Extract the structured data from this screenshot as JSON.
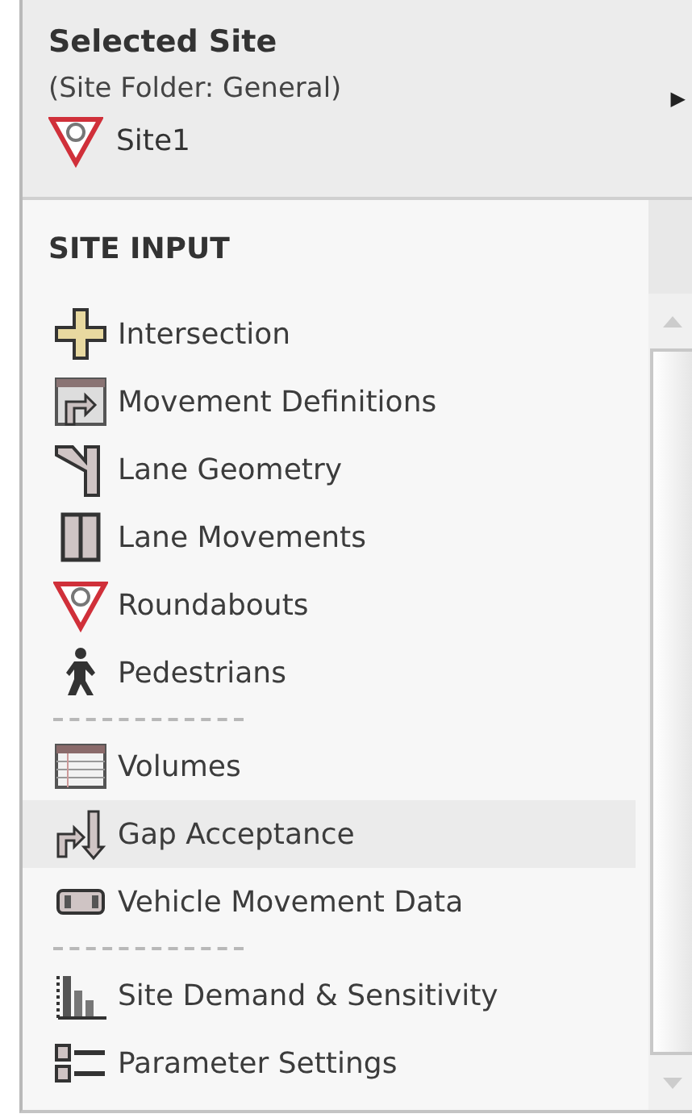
{
  "selected_site": {
    "title": "Selected Site",
    "folder": "(Site Folder: General)",
    "site": "Site1",
    "expand_arrow": "▶"
  },
  "section_title": "SITE INPUT",
  "entries": [
    {
      "kind": "item",
      "label": "Intersection",
      "selected": false
    },
    {
      "kind": "item",
      "label": "Movement Definitions",
      "selected": false
    },
    {
      "kind": "item",
      "label": "Lane Geometry",
      "selected": false
    },
    {
      "kind": "item",
      "label": "Lane Movements",
      "selected": false
    },
    {
      "kind": "item",
      "label": "Roundabouts",
      "selected": false
    },
    {
      "kind": "item",
      "label": "Pedestrians",
      "selected": false
    },
    {
      "kind": "separator"
    },
    {
      "kind": "item",
      "label": "Volumes",
      "selected": false
    },
    {
      "kind": "item",
      "label": "Gap Acceptance",
      "selected": true
    },
    {
      "kind": "item",
      "label": "Vehicle Movement Data",
      "selected": false
    },
    {
      "kind": "separator"
    },
    {
      "kind": "item",
      "label": "Site Demand & Sensitivity",
      "selected": false
    },
    {
      "kind": "item",
      "label": "Parameter Settings",
      "selected": false
    }
  ]
}
